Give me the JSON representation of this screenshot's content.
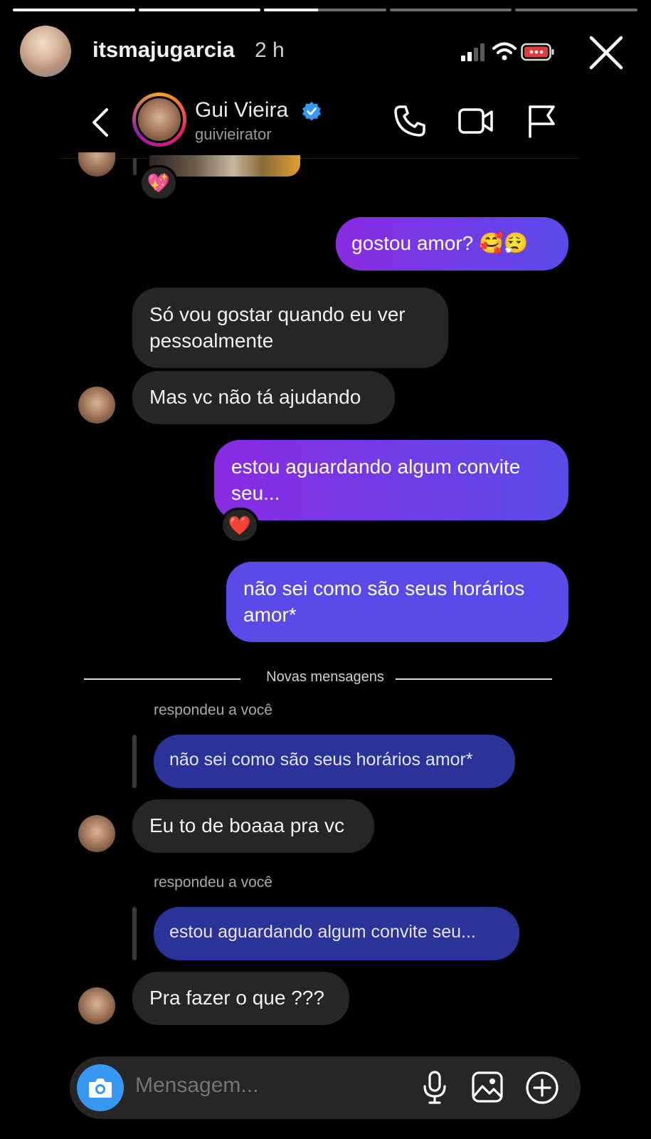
{
  "story": {
    "username": "itsmajugarcia",
    "time": "2 h",
    "segments_progress": [
      1,
      1,
      0.44,
      0,
      0
    ]
  },
  "chat_header": {
    "name": "Gui Vieira",
    "handle": "guivieirator",
    "verified": true
  },
  "messages": {
    "reaction_top": "💖",
    "m1": "gostou amor? 🥰😮‍💨",
    "m2": "Só vou gostar quando eu ver pessoalmente",
    "m3": "Mas vc não tá ajudando",
    "m4": "estou aguardando algum convite seu...",
    "m4_reaction": "❤️",
    "m5": "não sei como são seus horários amor*",
    "divider": "Novas mensagens",
    "reply1_label": "respondeu a você",
    "reply1_quote": "não sei como são seus horários amor*",
    "m6": "Eu to de boaaa pra vc",
    "reply2_label": "respondeu a você",
    "reply2_quote": "estou aguardando algum convite seu...",
    "m7": "Pra fazer o que ???"
  },
  "composer": {
    "placeholder": "Mensagem..."
  },
  "colors": {
    "outgoing_gradient": [
      "#8a2be2",
      "#5a4be8"
    ],
    "incoming": "#262626",
    "quote": "#2b3398",
    "camera": "#3897f0",
    "verified": "#3897f0"
  },
  "icons": [
    "signal-icon",
    "wifi-icon",
    "battery-icon",
    "close-icon",
    "back-icon",
    "verified-icon",
    "phone-icon",
    "video-icon",
    "flag-icon",
    "camera-icon",
    "mic-icon",
    "gallery-icon",
    "plus-icon"
  ]
}
